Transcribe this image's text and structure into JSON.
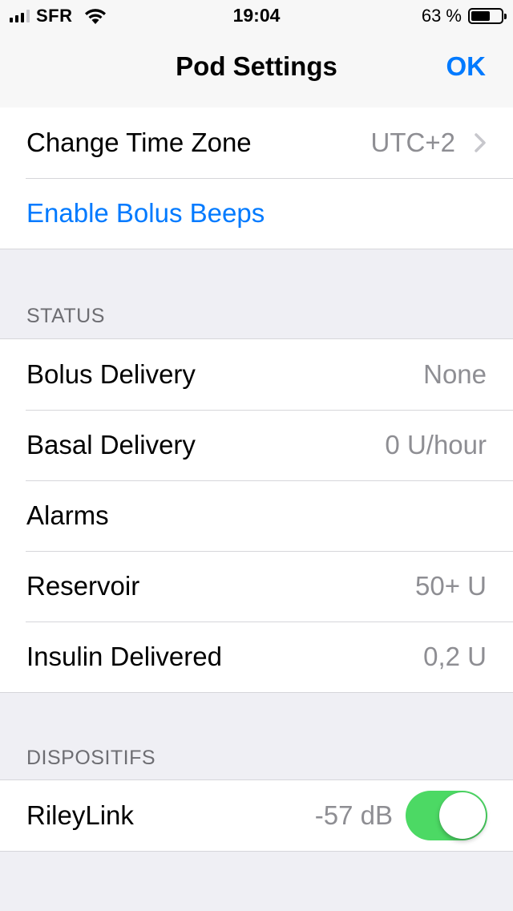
{
  "status_bar": {
    "carrier": "SFR",
    "time": "19:04",
    "battery_percent": "63 %",
    "battery_level": 0.63
  },
  "nav": {
    "title": "Pod Settings",
    "ok_label": "OK"
  },
  "settings": {
    "change_time_zone": {
      "label": "Change Time Zone",
      "value": "UTC+2"
    },
    "enable_bolus_beeps": {
      "label": "Enable Bolus Beeps"
    }
  },
  "status_section": {
    "header": "STATUS",
    "rows": [
      {
        "label": "Bolus Delivery",
        "value": "None"
      },
      {
        "label": "Basal Delivery",
        "value": "0 U/hour"
      },
      {
        "label": "Alarms",
        "value": ""
      },
      {
        "label": "Reservoir",
        "value": "50+ U"
      },
      {
        "label": "Insulin Delivered",
        "value": "0,2 U"
      }
    ]
  },
  "devices_section": {
    "header": "DISPOSITIFS",
    "rileylink": {
      "label": "RileyLink",
      "rssi": "-57 dB",
      "enabled": true
    }
  },
  "colors": {
    "accent": "#007aff",
    "toggle_on": "#4cd964",
    "background": "#efeff4"
  }
}
